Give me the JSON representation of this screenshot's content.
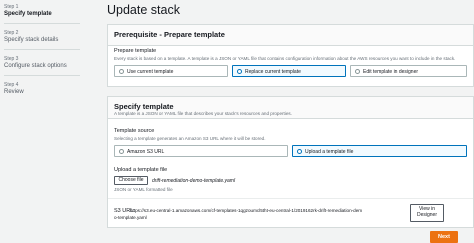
{
  "wizard": {
    "steps": [
      {
        "number": "Step 1",
        "label": "Specify template"
      },
      {
        "number": "Step 2",
        "label": "Specify stack details"
      },
      {
        "number": "Step 3",
        "label": "Configure stack options"
      },
      {
        "number": "Step 4",
        "label": "Review"
      }
    ]
  },
  "page": {
    "title": "Update stack"
  },
  "prerequisite": {
    "title": "Prerequisite - Prepare template",
    "field_label": "Prepare template",
    "description": "Every stack is based on a template. A template is a JSON or YAML file that contains configuration information about the AWS resources you want to include in the stack.",
    "options": [
      {
        "label": "Use current template",
        "selected": false
      },
      {
        "label": "Replace current template",
        "selected": true
      },
      {
        "label": "Edit template in designer",
        "selected": false
      }
    ]
  },
  "specify": {
    "title": "Specify template",
    "description": "A template is a JSON or YAML file that describes your stack's resources and properties.",
    "source_label": "Template source",
    "source_description": "Selecting a template generates an Amazon S3 URL where it will be stored.",
    "source_options": [
      {
        "label": "Amazon S3 URL",
        "selected": false
      },
      {
        "label": "Upload a template file",
        "selected": true
      }
    ],
    "upload_label": "Upload a template file",
    "choose_file_label": "Choose file",
    "file_name": "drift-remediation-demo-template.yaml",
    "file_hint": "JSON or YAML formatted file",
    "s3_url_label": "S3 URL:",
    "s3_url_line1": "https://s3.eu-central-1.amazonaws.com/cf-templates-1qgzoumcl5tht-eu-central-1/2019162rk-drift-remediation-dem",
    "s3_url_line2": "o-template.yaml",
    "view_designer_label": "View in Designer"
  },
  "footer": {
    "next_label": "Next"
  },
  "colors": {
    "accent": "#0073bb",
    "primary_button": "#ec7211"
  }
}
